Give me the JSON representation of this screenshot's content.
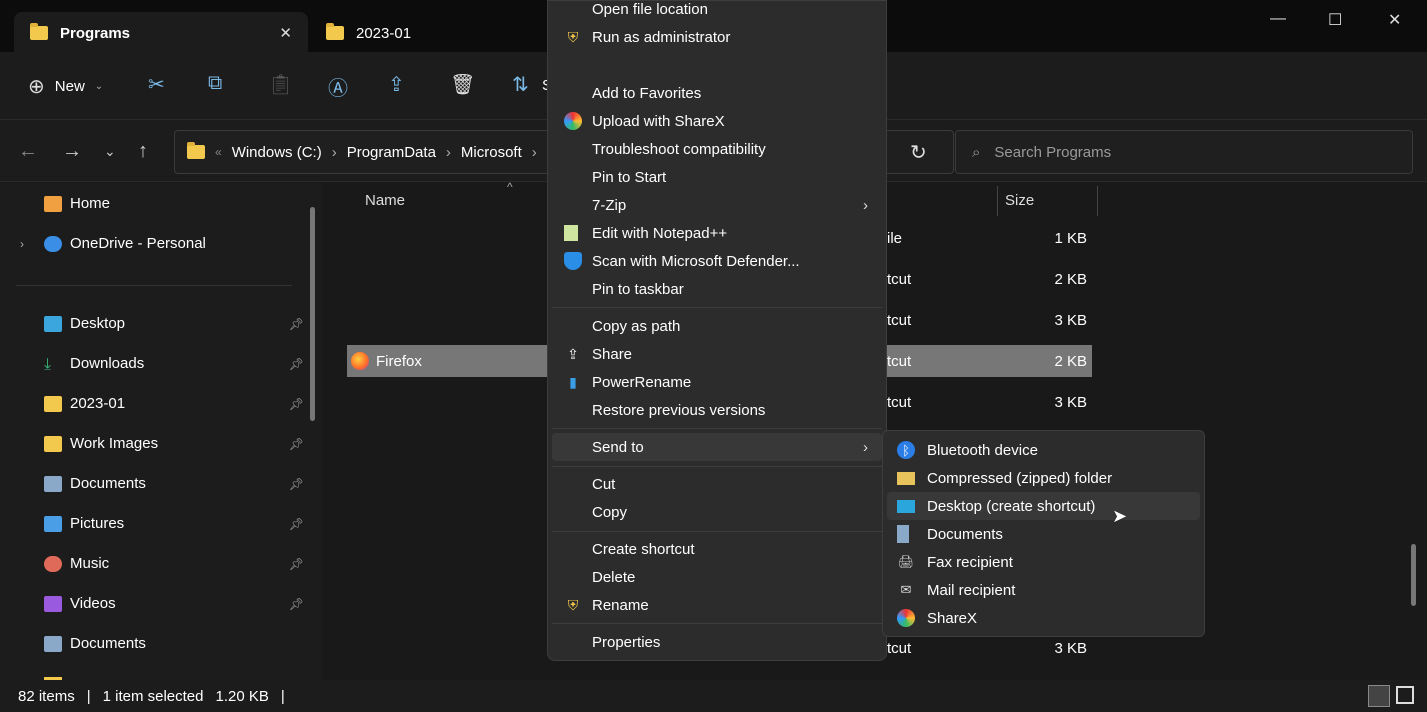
{
  "tabs": [
    {
      "label": "Programs",
      "active": true
    },
    {
      "label": "2023-01",
      "active": false
    }
  ],
  "window_controls": {
    "minimize": "—",
    "maximize": "☐",
    "close": "✕"
  },
  "toolbar": {
    "new_label": "New",
    "sort_label": "S"
  },
  "address": {
    "overflow": "«",
    "crumbs": [
      "Windows (C:)",
      "ProgramData",
      "Microsoft"
    ]
  },
  "search": {
    "placeholder": "Search Programs"
  },
  "sidebar": {
    "items": [
      {
        "label": "Home",
        "icon": "home-icon",
        "color": "#f0a040",
        "pinned": false
      },
      {
        "label": "OneDrive - Personal",
        "icon": "cloud-icon",
        "color": "#3a8ee6",
        "pinned": false
      },
      {
        "label": "Desktop",
        "icon": "desktop-icon",
        "color": "#3aa6dd",
        "pinned": true
      },
      {
        "label": "Downloads",
        "icon": "download-icon",
        "color": "#3ab87a",
        "pinned": true
      },
      {
        "label": "2023-01",
        "icon": "folder-icon",
        "color": "#f2c94c",
        "pinned": true
      },
      {
        "label": "Work Images",
        "icon": "folder-icon",
        "color": "#f2c94c",
        "pinned": true
      },
      {
        "label": "Documents",
        "icon": "document-icon",
        "color": "#8aa8c8",
        "pinned": true
      },
      {
        "label": "Pictures",
        "icon": "pictures-icon",
        "color": "#4a9ee6",
        "pinned": true
      },
      {
        "label": "Music",
        "icon": "music-icon",
        "color": "#e06a5a",
        "pinned": true
      },
      {
        "label": "Videos",
        "icon": "videos-icon",
        "color": "#9a5ae0",
        "pinned": true
      },
      {
        "label": "Documents",
        "icon": "document-icon",
        "color": "#8aa8c8",
        "pinned": false
      }
    ]
  },
  "columns": {
    "name": "Name",
    "size": "Size"
  },
  "files": [
    {
      "name": "",
      "type": "ile",
      "size": "1 KB"
    },
    {
      "name": "",
      "type": "tcut",
      "size": "2 KB"
    },
    {
      "name": "",
      "type": "tcut",
      "size": "3 KB"
    },
    {
      "name": "Firefox",
      "type": "tcut",
      "size": "2 KB",
      "selected": true
    },
    {
      "name": "",
      "type": "tcut",
      "size": "3 KB"
    },
    {
      "name": "",
      "type": "tcut",
      "size": "3 KB"
    }
  ],
  "context_menu": {
    "items": [
      {
        "label": "Open file location",
        "icon": ""
      },
      {
        "label": "Run as administrator",
        "icon": "shield-icon"
      },
      {
        "label": "Add to Favorites",
        "icon": ""
      },
      {
        "label": "Upload with ShareX",
        "icon": "sharex-icon"
      },
      {
        "label": "Troubleshoot compatibility",
        "icon": ""
      },
      {
        "label": "Pin to Start",
        "icon": ""
      },
      {
        "label": "7-Zip",
        "icon": "",
        "submenu": true
      },
      {
        "label": "Edit with Notepad++",
        "icon": "notepad-icon"
      },
      {
        "label": "Scan with Microsoft Defender...",
        "icon": "defender-icon"
      },
      {
        "label": "Pin to taskbar",
        "icon": ""
      },
      {
        "label": "Copy as path",
        "icon": ""
      },
      {
        "label": "Share",
        "icon": "share-icon"
      },
      {
        "label": "PowerRename",
        "icon": "powerrename-icon"
      },
      {
        "label": "Restore previous versions",
        "icon": ""
      },
      {
        "label": "Send to",
        "icon": "",
        "submenu": true
      },
      {
        "label": "Cut",
        "icon": ""
      },
      {
        "label": "Copy",
        "icon": ""
      },
      {
        "label": "Create shortcut",
        "icon": ""
      },
      {
        "label": "Delete",
        "icon": ""
      },
      {
        "label": "Rename",
        "icon": "shield-icon"
      },
      {
        "label": "Properties",
        "icon": ""
      }
    ]
  },
  "send_to": {
    "items": [
      {
        "label": "Bluetooth device",
        "icon": "bluetooth-icon"
      },
      {
        "label": "Compressed (zipped) folder",
        "icon": "zip-folder-icon"
      },
      {
        "label": "Desktop (create shortcut)",
        "icon": "desktop-icon",
        "highlighted": true
      },
      {
        "label": "Documents",
        "icon": "document-icon"
      },
      {
        "label": "Fax recipient",
        "icon": "fax-icon"
      },
      {
        "label": "Mail recipient",
        "icon": "mail-icon"
      },
      {
        "label": "ShareX",
        "icon": "sharex-icon"
      }
    ]
  },
  "status": {
    "items": "82 items",
    "selected": "1 item selected",
    "size": "1.20 KB",
    "sep": "|"
  }
}
